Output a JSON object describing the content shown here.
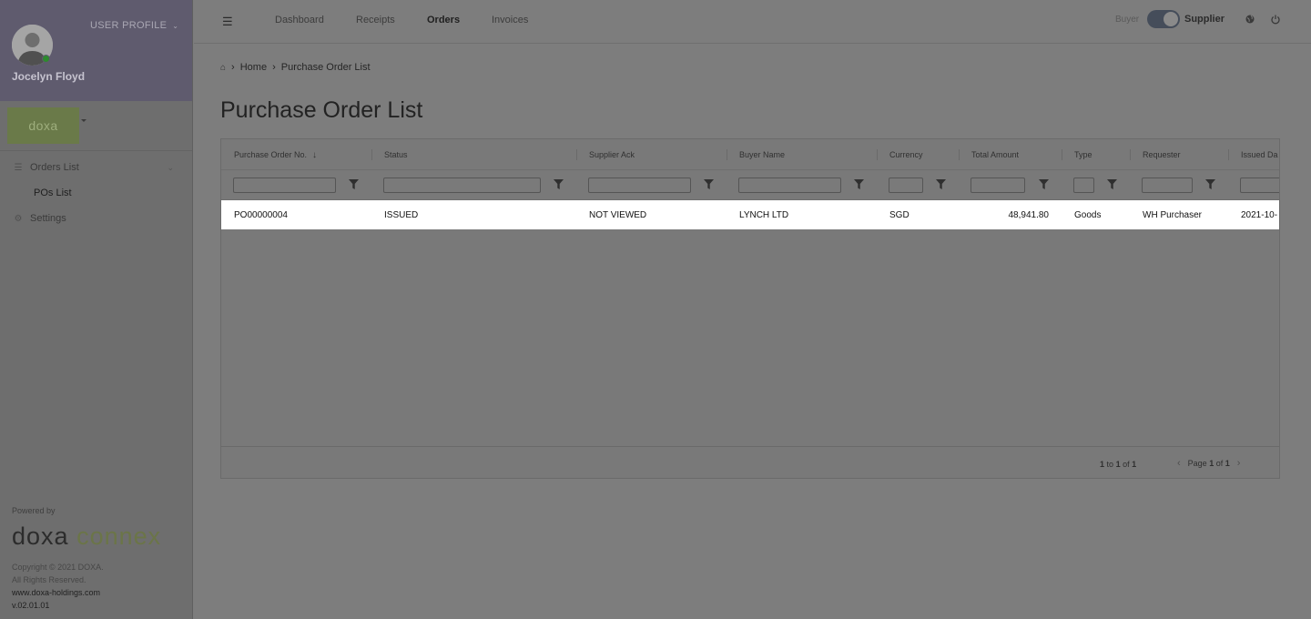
{
  "sidebar": {
    "profile_menu_label": "USER PROFILE",
    "user_name": "Jocelyn Floyd",
    "company_logo_text": "doxa",
    "nav": [
      {
        "label": "Orders List",
        "icon": "list-icon"
      },
      {
        "label": "POs List"
      },
      {
        "label": "Settings",
        "icon": "gear-icon"
      }
    ],
    "powered_by": "Powered by",
    "brand_part1": "doxa",
    "brand_part2": "connex",
    "copyright": "Copyright © 2021 DOXA.",
    "rights": "All Rights Reserved.",
    "website": "www.doxa-holdings.com",
    "version": "v.02.01.01"
  },
  "topbar": {
    "tabs": [
      "Dashboard",
      "Receipts",
      "Orders",
      "Invoices"
    ],
    "active_tab": "Orders",
    "buyer_label": "Buyer",
    "supplier_label": "Supplier",
    "mode_selected": "Supplier"
  },
  "breadcrumb": {
    "home": "Home",
    "current": "Purchase Order List"
  },
  "page_title": "Purchase Order List",
  "grid": {
    "columns": [
      "Purchase Order No.",
      "Status",
      "Supplier Ack",
      "Buyer Name",
      "Currency",
      "Total Amount",
      "Type",
      "Requester",
      "Issued Da"
    ],
    "sort_indicator": "↓",
    "rows": [
      [
        "PO00000004",
        "ISSUED",
        "NOT VIEWED",
        "LYNCH LTD",
        "SGD",
        "48,941.80",
        "Goods",
        "WH Purchaser",
        "2021-10-"
      ]
    ],
    "footer": {
      "range_from": "1",
      "to_word": "to",
      "range_to": "1",
      "of_word": "of",
      "total": "1",
      "page_word": "Page",
      "page": "1",
      "page_of": "of",
      "pages": "1"
    }
  },
  "colors": {
    "accent_green": "#6b7548",
    "online": "#2d8a2d"
  }
}
